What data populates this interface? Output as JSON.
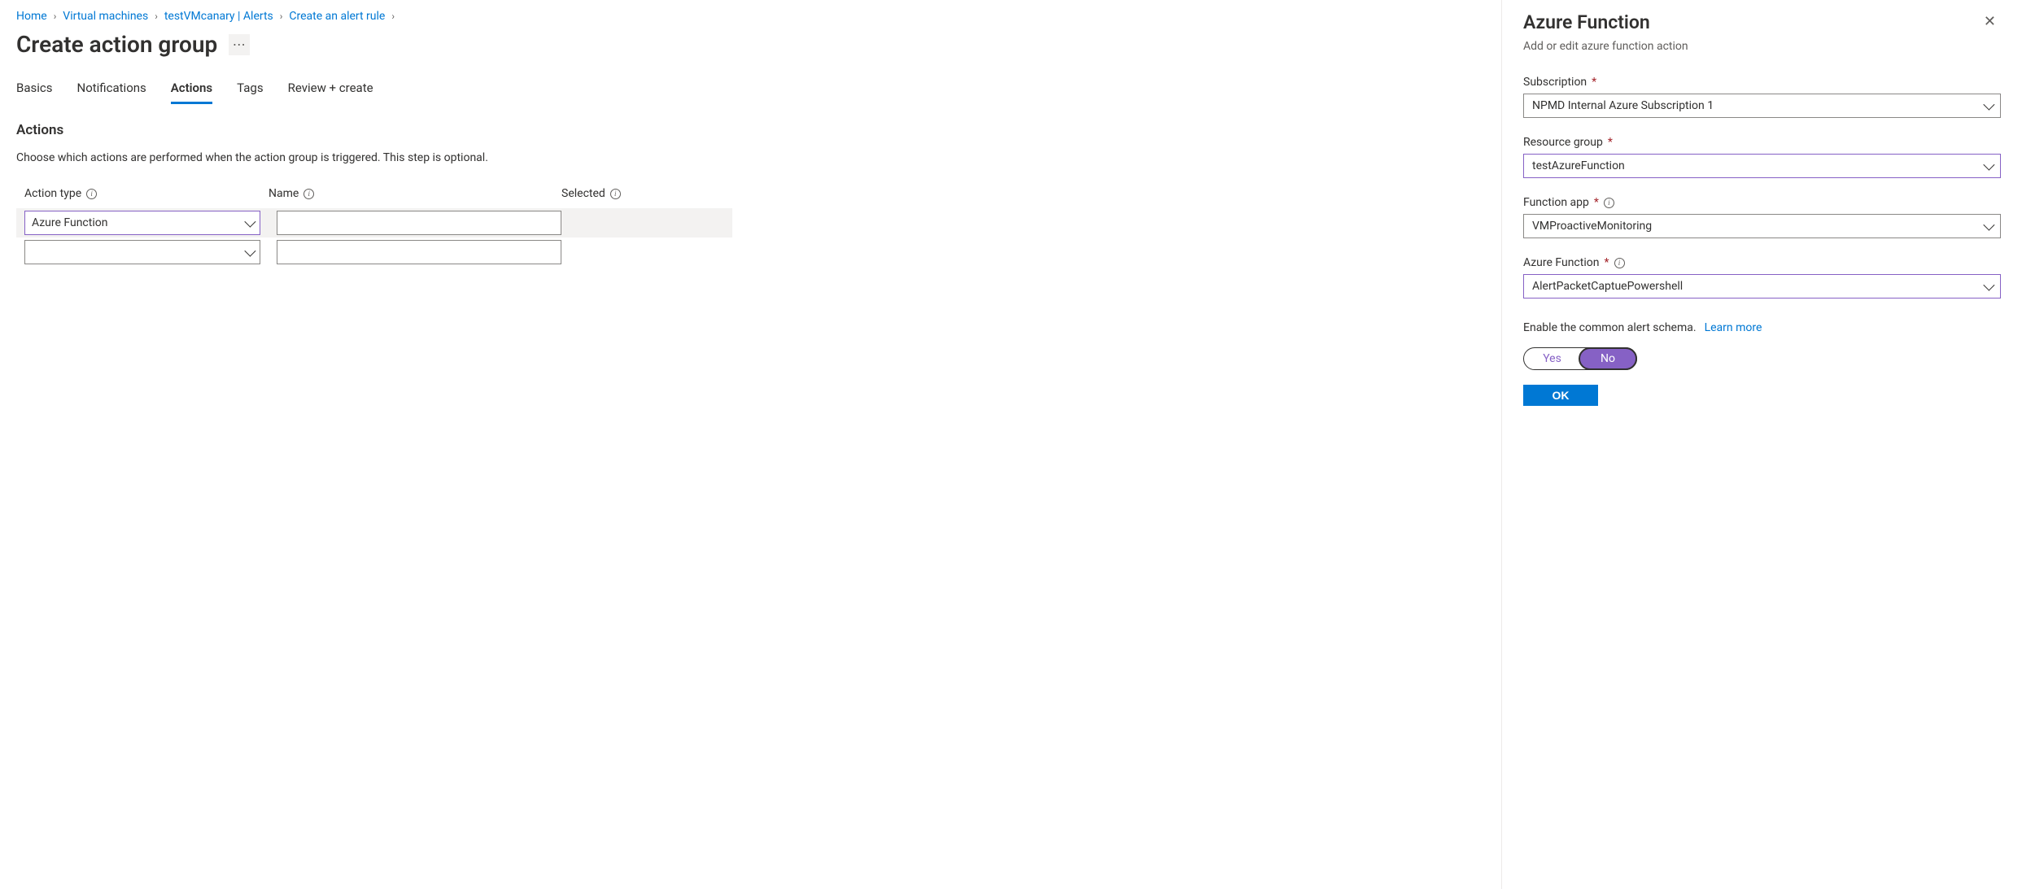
{
  "breadcrumbs": [
    {
      "label": "Home"
    },
    {
      "label": "Virtual machines"
    },
    {
      "label": "testVMcanary | Alerts"
    },
    {
      "label": "Create an alert rule"
    }
  ],
  "page_title": "Create action group",
  "tabs": [
    {
      "label": "Basics",
      "active": false
    },
    {
      "label": "Notifications",
      "active": false
    },
    {
      "label": "Actions",
      "active": true
    },
    {
      "label": "Tags",
      "active": false
    },
    {
      "label": "Review + create",
      "active": false
    }
  ],
  "section_heading": "Actions",
  "section_desc": "Choose which actions are performed when the action group is triggered. This step is optional.",
  "table": {
    "headers": {
      "type": "Action type",
      "name": "Name",
      "selected": "Selected"
    },
    "rows": [
      {
        "type": "Azure Function",
        "name": "",
        "highlight": true,
        "type_selected": true
      },
      {
        "type": "",
        "name": "",
        "highlight": false,
        "type_selected": false
      }
    ]
  },
  "panel": {
    "title": "Azure Function",
    "subtitle": "Add or edit azure function action",
    "fields": {
      "subscription": {
        "label": "Subscription",
        "value": "NPMD Internal Azure Subscription 1",
        "required": true,
        "info": false,
        "focus": false
      },
      "resource_group": {
        "label": "Resource group",
        "value": "testAzureFunction",
        "required": true,
        "info": false,
        "focus": true
      },
      "function_app": {
        "label": "Function app",
        "value": "VMProactiveMonitoring",
        "required": true,
        "info": true,
        "focus": false
      },
      "azure_function": {
        "label": "Azure Function",
        "value": "AlertPacketCaptuePowershell",
        "required": true,
        "info": true,
        "focus": true
      }
    },
    "schema_text": "Enable the common alert schema.",
    "schema_link": "Learn more",
    "toggle": {
      "yes": "Yes",
      "no": "No",
      "value": "No"
    },
    "ok_label": "OK"
  }
}
